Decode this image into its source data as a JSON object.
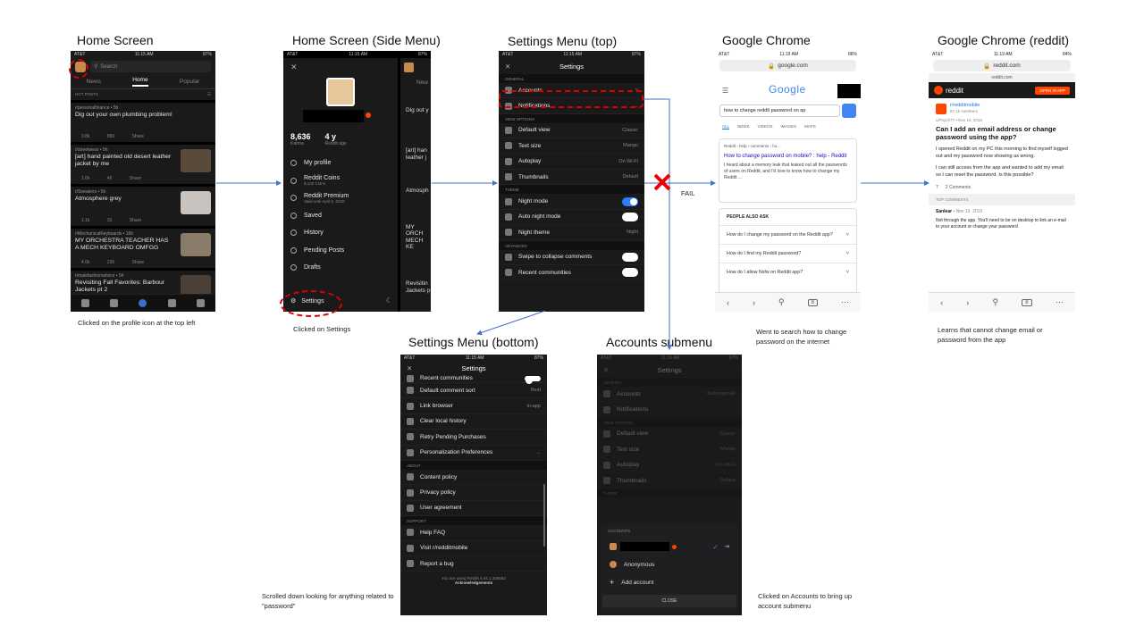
{
  "titles": {
    "home": "Home Screen",
    "side": "Home Screen (Side Menu)",
    "settings_top": "Settings Menu (top)",
    "chrome": "Google Chrome",
    "chrome_reddit": "Google Chrome (reddit)",
    "settings_bottom": "Settings Menu (bottom)",
    "accounts": "Accounts submenu"
  },
  "captions": {
    "home": "Clicked on the profile icon at the top left",
    "side": "Clicked on Settings",
    "chrome": "Went to search  how to change password on the internet",
    "chrome_reddit": "Learns  that  cannot change email  or password from the app",
    "settings_bottom": "Scrolled  down looking for anything related to  \"password\"",
    "accounts": "Clicked on Accounts to bring up account submenu",
    "fail": "FAIL"
  },
  "status": {
    "carrier": "AT&T",
    "t1115": "11:15 AM",
    "t1116": "11:16 AM",
    "t1119": "11:19 AM",
    "b87": "87%",
    "b86": "86%",
    "b84": "84%"
  },
  "home": {
    "search": "Search",
    "tabs": [
      "News",
      "Home",
      "Popular"
    ],
    "sort": "HOT POSTS",
    "share": "Share",
    "posts": [
      {
        "sub": "r/personalfinance • 5h",
        "title": "Dig out your own plumbing problem!",
        "votes": "3.8k",
        "comments": "850"
      },
      {
        "sub": "r/streetwear • 5h",
        "title": "[art] hand painted old desert leather jacket by me",
        "votes": "1.6k",
        "comments": "46"
      },
      {
        "sub": "r/Sneakers • 5h",
        "title": "Atmosphere grey",
        "votes": "1.1k",
        "comments": "31"
      },
      {
        "sub": "r/MechanicalKeyboards • 16h",
        "title": "MY ORCHESTRA TEACHER HAS A MECH KEYBOARD OMFGG",
        "votes": "4.0k",
        "comments": "235"
      },
      {
        "sub": "r/malefashionadvice • 5h",
        "title": "Revisiting Fall Favorites: Barbour Jackets pt 2",
        "votes": "",
        "comments": ""
      }
    ]
  },
  "side": {
    "karma": "8,636",
    "karma_label": "Karma",
    "age": "4 y",
    "age_label": "Reddit age",
    "items": [
      "My profile",
      "Reddit Coins",
      "Reddit Premium",
      "Saved",
      "History",
      "Pending Posts",
      "Drafts"
    ],
    "coins_sub": "9,100 Coins",
    "premium_sub": "Valid until April 5, 2020",
    "settings": "Settings",
    "peek_titles": [
      "Dig out y",
      "[art] han",
      "leather j",
      "Atmosph",
      "MY ORCH",
      "MECH KE",
      "Revisitin",
      "Jackets p"
    ],
    "peek_news": "New"
  },
  "settings_top": {
    "header": "Settings",
    "general": "GENERAL",
    "accounts": "Accounts",
    "notifications": "Notifications",
    "view_options": "VIEW OPTIONS",
    "rows": [
      {
        "label": "Default view",
        "val": "Classic"
      },
      {
        "label": "Text size",
        "val": "Mango"
      },
      {
        "label": "Autoplay",
        "val": "On Wi-Fi"
      },
      {
        "label": "Thumbnails",
        "val": "Default"
      }
    ],
    "theme": "THEME",
    "night_mode": "Night mode",
    "auto_night": "Auto night mode",
    "night_theme": "Night theme",
    "night_theme_val": "Night",
    "advanced": "ADVANCED",
    "swipe": "Swipe to collapse comments",
    "recent": "Recent communities"
  },
  "settings_bottom": {
    "header": "Settings",
    "recent": "Recent communities",
    "comment_sort": "Default comment sort",
    "comment_sort_val": "Best",
    "link_browser": "Link browser",
    "link_browser_val": "In-app",
    "clear": "Clear local history",
    "retry": "Retry Pending Purchases",
    "personalization": "Personalization Preferences",
    "about": "ABOUT",
    "content": "Content policy",
    "privacy": "Privacy policy",
    "user_agreement": "User agreement",
    "support": "SUPPORT",
    "help": "Help FAQ",
    "visit": "Visit r/redditmobile",
    "report": "Report a bug",
    "version": "You are using Reddit 4.44.1.306563",
    "ack": "Acknowledgements"
  },
  "accounts": {
    "header": "Settings",
    "general": "GENERAL",
    "accounts": "Accounts",
    "accounts_val": "darkyngoode",
    "notifications": "Notifications",
    "view_options": "VIEW OPTIONS",
    "rows": [
      {
        "label": "Default view",
        "val": "Classic"
      },
      {
        "label": "Text size",
        "val": "Mango"
      },
      {
        "label": "Autoplay",
        "val": "On Wi-Fi"
      },
      {
        "label": "Thumbnails",
        "val": "Default"
      }
    ],
    "theme": "THEME",
    "sheet_title": "ACCOUNTS",
    "anonymous": "Anonymous",
    "add": "Add account",
    "close": "CLOSE"
  },
  "chrome": {
    "url": "google.com",
    "logo": "Google",
    "query": "how to change reddit password on ap",
    "tabs": [
      "ALL",
      "NEWS",
      "VIDEOS",
      "IMAGES",
      "MAPS"
    ],
    "result_src": "Reddit › help › comments › ho...",
    "result_title": "How to change password on mobile? : help - Reddit",
    "result_snip": "I heard about a memory leak that leaked out all the passwords of users on Reddit, and I'd love to know how to change my Reddit ...",
    "paa": "PEOPLE ALSO ASK",
    "questions": [
      "How do I change my password on the Reddit app?",
      "How do I find my Reddit password?",
      "How do I allow Nsfw on Reddit app?"
    ],
    "tabs_count": "8"
  },
  "chrome_reddit": {
    "url": "reddit.com",
    "subbar": "reddit.com",
    "brand": "reddit",
    "open_app": "OPEN IN APP",
    "community": "r/redditmobile",
    "members": "87.1k members",
    "by": "u/Psych77 • Nov 19, 2016",
    "title": "Can I add an email address or change password using the app?",
    "p1": "I opened Reddit on my PC this morning to find myself logged out and my password now showing as wrong.",
    "p2": "I can still access from the app and wanted to add my email so I can reset the password. Is this possible?",
    "votes": "7",
    "comments": "2 Comments",
    "top": "TOP COMMENTS",
    "commenter": "Sanlear",
    "cdate": "• Nov 19, 2016",
    "comment": "Not through the app. You'll need to be on desktop to link an e-mail to your account or change your password"
  }
}
